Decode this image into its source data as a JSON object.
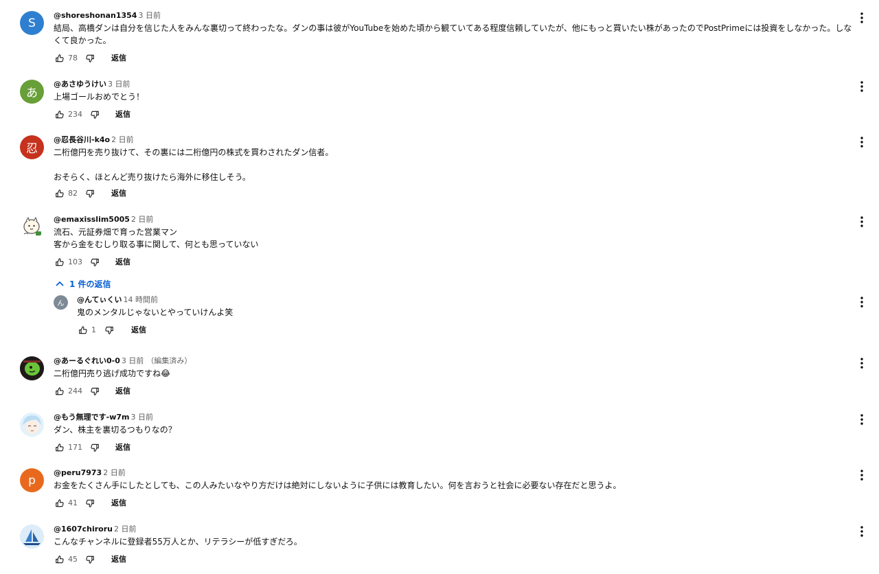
{
  "comments": [
    {
      "author": "@shoreshonan1354",
      "time": "3 日前",
      "edited": "",
      "text": "結局、高橋ダンは自分を信じた人をみんな裏切って終わったな。ダンの事は彼がYouTubeを始めた頃から観ていてある程度信頼していたが、他にもっと買いたい株があったのでPostPrimeには投資をしなかった。しなくて良かった。",
      "likes": "78",
      "reply_label": "返信",
      "avatar": {
        "type": "letter",
        "letter": "S",
        "color": "#2f7fd0"
      }
    },
    {
      "author": "@あさゆうけい",
      "time": "3 日前",
      "edited": "",
      "text": "上場ゴールおめでとう！",
      "likes": "234",
      "reply_label": "返信",
      "avatar": {
        "type": "letter",
        "letter": "あ",
        "color": "#689f38"
      }
    },
    {
      "author": "@忍長谷川-k4o",
      "time": "2 日前",
      "edited": "",
      "text": "二桁億円を売り抜けて、その裏には二桁億円の株式を買わされたダン信者。\n\nおそらく、ほとんど売り抜けたら海外に移住しそう。",
      "likes": "82",
      "reply_label": "返信",
      "avatar": {
        "type": "letter",
        "letter": "忍",
        "color": "#c5321d"
      }
    },
    {
      "author": "@emaxisslim5005",
      "time": "2 日前",
      "edited": "",
      "text": "流石、元証券畑で育った営業マン\n客から金をむしり取る事に関して、何とも思っていない",
      "likes": "103",
      "reply_label": "返信",
      "avatar": {
        "type": "image",
        "icon": "cartoon-face-icon"
      },
      "replies_toggle": "1 件の返信"
    },
    {
      "author": "@あーるぐれい0-0",
      "time": "3 日前",
      "edited": "（編集済み）",
      "text": "二桁億円売り逃げ成功ですね😂",
      "likes": "244",
      "reply_label": "返信",
      "avatar": {
        "type": "image",
        "icon": "green-blob-icon"
      }
    },
    {
      "author": "@もう無理です-w7m",
      "time": "3 日前",
      "edited": "",
      "text": "ダン、株主を裏切るつもりなの？",
      "likes": "171",
      "reply_label": "返信",
      "avatar": {
        "type": "image",
        "icon": "anime-face-icon"
      }
    },
    {
      "author": "@peru7973",
      "time": "2 日前",
      "edited": "",
      "text": "お金をたくさん手にしたとしても、この人みたいなやり方だけは絶対にしないように子供には教育したい。何を言おうと社会に必要ない存在だと思うよ。",
      "likes": "41",
      "reply_label": "返信",
      "avatar": {
        "type": "letter",
        "letter": "p",
        "color": "#e8691e"
      }
    },
    {
      "author": "@1607chiroru",
      "time": "2 日前",
      "edited": "",
      "text": "こんなチャンネルに登録者55万人とか、リテラシーが低すぎだろ。",
      "likes": "45",
      "reply_label": "返信",
      "avatar": {
        "type": "image",
        "icon": "sailboat-icon"
      }
    }
  ],
  "reply": {
    "author": "@んてぃくい",
    "time": "14 時間前",
    "text": "鬼のメンタルじゃないとやっていけんよ笑",
    "likes": "1",
    "reply_label": "返信",
    "avatar": {
      "type": "letter",
      "letter": "ん",
      "color": "#7d8a96"
    }
  },
  "icons": {
    "like": "thumb-up-icon",
    "dislike": "thumb-down-icon",
    "more": "more-vert-icon",
    "toggle": "chevron-up-icon"
  },
  "colors": {
    "link_blue": "#065fd4",
    "secondary_text": "#606060"
  }
}
